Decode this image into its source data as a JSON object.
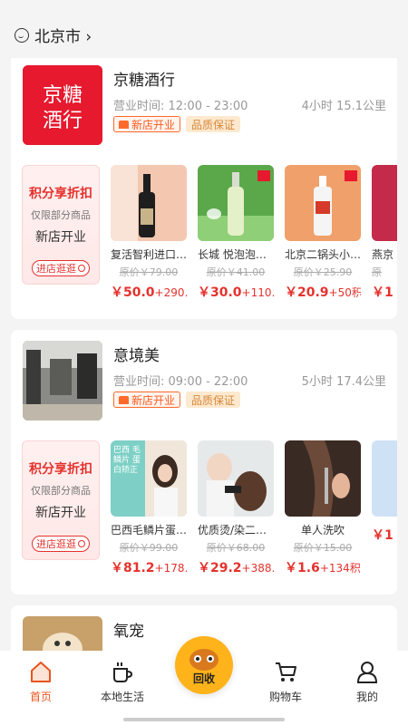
{
  "header": {
    "city": "北京市 ›"
  },
  "stores": [
    {
      "name": "京糖酒行",
      "logo_text": "京糖酒行",
      "hours": "营业时间: 12:00 - 23:00",
      "distance": "4小时 15.1公里",
      "tag_new": "新店开业",
      "tag_quality": "品质保证",
      "promo": {
        "title": "积分享折扣",
        "sub": "仅限部分商品",
        "newshop": "新店开业",
        "button": "进店逛逛"
      },
      "products": [
        {
          "name": "复活智利进口…",
          "orig": "原价￥79.00",
          "price_main": "￥50.0",
          "price_extra": "+290…"
        },
        {
          "name": "长城 悦泡泡白…",
          "orig": "原价￥41.00",
          "price_main": "￥30.0",
          "price_extra": "+110…"
        },
        {
          "name": "北京二锅头小…",
          "orig": "原价￥25.90",
          "price_main": "￥20.9",
          "price_extra": "+50积分"
        },
        {
          "name": "燕京",
          "orig": "原",
          "price_main": "￥1",
          "price_extra": ""
        }
      ]
    },
    {
      "name": "意境美",
      "hours": "营业时间: 09:00 - 22:00",
      "distance": "5小时 17.4公里",
      "tag_new": "新店开业",
      "tag_quality": "品质保证",
      "promo": {
        "title": "积分享折扣",
        "sub": "仅限部分商品",
        "newshop": "新店开业",
        "button": "进店逛逛"
      },
      "products": [
        {
          "name": "巴西毛鳞片蛋…",
          "orig": "原价￥99.00",
          "price_main": "￥81.2",
          "price_extra": "+178…",
          "img_text": "巴西 毛鳞片 蛋白矫正"
        },
        {
          "name": "优质烫/染二选…",
          "orig": "原价￥68.00",
          "price_main": "￥29.2",
          "price_extra": "+388…"
        },
        {
          "name": "单人洗吹",
          "orig": "原价￥15.00",
          "price_main": "￥1.6",
          "price_extra": "+134积分"
        },
        {
          "name": "",
          "orig": "",
          "price_main": "￥1",
          "price_extra": ""
        }
      ]
    },
    {
      "name": "氧宠"
    }
  ],
  "nav": {
    "home": "首页",
    "local": "本地生活",
    "recycle": "回收",
    "cart": "购物车",
    "mine": "我的"
  },
  "colors": {
    "accent": "#e8541e",
    "price": "#e5322d",
    "recycle": "#ffb31a"
  }
}
